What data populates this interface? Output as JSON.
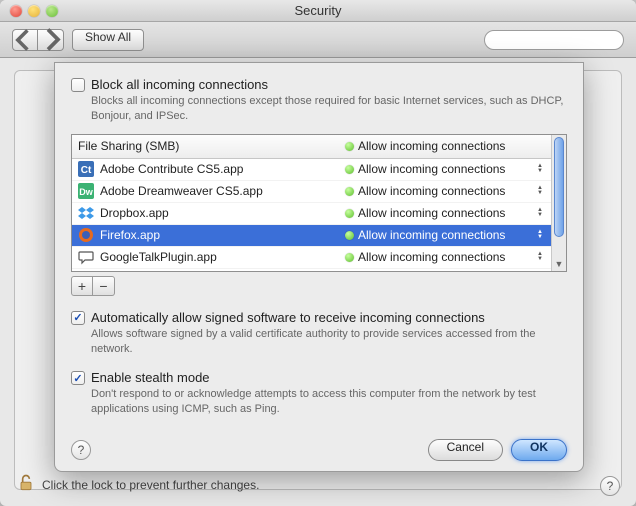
{
  "window": {
    "title": "Security"
  },
  "toolbar": {
    "show_all": "Show All",
    "search_placeholder": ""
  },
  "sheet": {
    "block_all": {
      "checked": false,
      "label": "Block all incoming connections",
      "sub": "Blocks all incoming connections except those required for basic Internet services, such as DHCP, Bonjour, and IPSec."
    },
    "header_app": "File Sharing (SMB)",
    "header_status": "Allow incoming connections",
    "apps": [
      {
        "icon": "contribute-icon",
        "name": "Adobe Contribute CS5.app",
        "status": "Allow incoming connections",
        "selected": false
      },
      {
        "icon": "dreamweaver-icon",
        "name": "Adobe Dreamweaver CS5.app",
        "status": "Allow incoming connections",
        "selected": false
      },
      {
        "icon": "dropbox-icon",
        "name": "Dropbox.app",
        "status": "Allow incoming connections",
        "selected": false
      },
      {
        "icon": "firefox-icon",
        "name": "Firefox.app",
        "status": "Allow incoming connections",
        "selected": true
      },
      {
        "icon": "googletalk-icon",
        "name": "GoogleTalkPlugin.app",
        "status": "Allow incoming connections",
        "selected": false
      }
    ],
    "auto_allow": {
      "checked": true,
      "label": "Automatically allow signed software to receive incoming connections",
      "sub": "Allows software signed by a valid certificate authority to provide services accessed from the network."
    },
    "stealth": {
      "checked": true,
      "label": "Enable stealth mode",
      "sub": "Don't respond to or acknowledge attempts to access this computer from the network by test applications using ICMP, such as Ping."
    },
    "cancel": "Cancel",
    "ok": "OK"
  },
  "lock_hint": "Click the lock to prevent further changes."
}
